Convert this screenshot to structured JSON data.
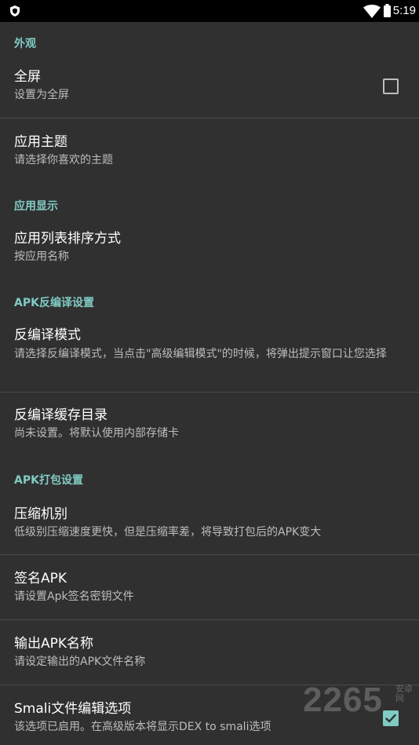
{
  "status_bar": {
    "time": "5:19",
    "icons": [
      "shield-notification-icon",
      "wifi-icon",
      "battery-icon"
    ]
  },
  "colors": {
    "background": "#303030",
    "status_bar": "#000000",
    "accent": "#80cbc4",
    "title_text": "#ffffff",
    "summary_text": "#bdbdbd",
    "divider": "#4a4a4a"
  },
  "sections": {
    "appearance": {
      "header": "外观",
      "fullscreen": {
        "title": "全屏",
        "summary": "设置为全屏",
        "checked": false
      },
      "theme": {
        "title": "应用主题",
        "summary": "请选择你喜欢的主题"
      }
    },
    "app_display": {
      "header": "应用显示",
      "sort": {
        "title": "应用列表排序方式",
        "summary": "按应用名称"
      }
    },
    "decompile": {
      "header": "APK反编译设置",
      "mode": {
        "title": "反编译模式",
        "summary": "请选择反编译模式，当点击\"高级编辑模式\"的时候，将弹出提示窗口让您选择"
      },
      "cache_dir": {
        "title": "反编译缓存目录",
        "summary": "尚未设置。将默认使用内部存储卡"
      }
    },
    "build": {
      "header": "APK打包设置",
      "compression": {
        "title": "压缩机别",
        "summary": "低级别压缩速度更快，但是压缩率差，将导致打包后的APK变大"
      },
      "sign": {
        "title": "签名APK",
        "summary": "请设置Apk签名密钥文件"
      },
      "output_name": {
        "title": "输出APK名称",
        "summary": "请设定输出的APK文件名称"
      },
      "smali": {
        "title": "Smali文件编辑选项",
        "summary": "该选项已启用。在高级版本将显示DEX to smali选项",
        "checked": true
      }
    }
  },
  "watermark": {
    "digits": "2265",
    "sub": "安卓网"
  }
}
